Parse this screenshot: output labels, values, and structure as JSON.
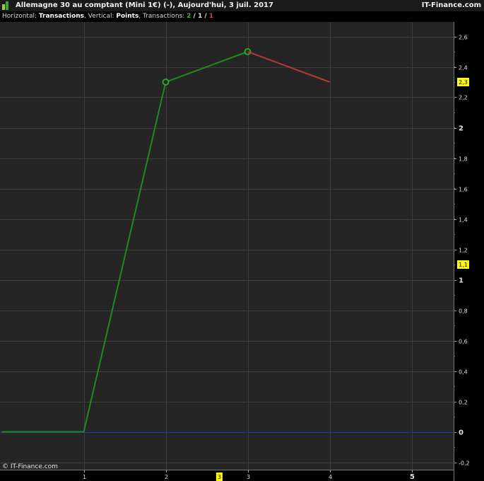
{
  "header": {
    "title": "Allemagne 30 au comptant (Mini 1€) (-), Aujourd'hui, 3 juil. 2017",
    "brand": "IT-Finance.com"
  },
  "subtitle": {
    "horizontal_label": "Horizontal:",
    "horizontal_value": "Transactions",
    "vertical_label": ", Vertical:",
    "vertical_value": "Points",
    "transactions_label": ", Transactions:",
    "count_green": "2",
    "sep1": " / ",
    "count_white": "1",
    "sep2": " / ",
    "count_red": "1"
  },
  "footer": {
    "copyright": "© IT-Finance.com"
  },
  "colors": {
    "background": "#252525",
    "grid": "#3e3e3e",
    "up": "#1f8a1f",
    "down": "#b33a33",
    "zero_line": "#2430b8",
    "highlight": "#ffff00"
  },
  "chart_data": {
    "type": "line",
    "x_ticks": [
      "1",
      "2",
      "3",
      "4",
      "5"
    ],
    "y_ticks": [
      "-0,2",
      "0",
      "0,2",
      "0,4",
      "0,6",
      "0,8",
      "1",
      "1,2",
      "1,4",
      "1,6",
      "1,8",
      "2",
      "2,2",
      "2,4",
      "2,6"
    ],
    "y_tick_values": [
      -0.2,
      0,
      0.2,
      0.4,
      0.6,
      0.8,
      1,
      1.2,
      1.4,
      1.6,
      1.8,
      2,
      2.2,
      2.4,
      2.6
    ],
    "xlim": [
      0,
      5.5
    ],
    "ylim": [
      -0.25,
      2.7
    ],
    "series": [
      {
        "color": "up",
        "points": [
          [
            0,
            0
          ],
          [
            1,
            0
          ],
          [
            2,
            2.3
          ],
          [
            3,
            2.5
          ]
        ],
        "markers": [
          2,
          3
        ]
      },
      {
        "color": "down",
        "points": [
          [
            3,
            2.5
          ],
          [
            4,
            2.3
          ]
        ],
        "markers": []
      }
    ],
    "highlight_labels": [
      {
        "axis": "y",
        "value": 2.3,
        "text": "2,3"
      },
      {
        "axis": "y",
        "value": 1.1,
        "text": "1,1"
      },
      {
        "axis": "x",
        "value": 2.65,
        "text": "3"
      }
    ],
    "zero_line": 0,
    "grid": true
  }
}
